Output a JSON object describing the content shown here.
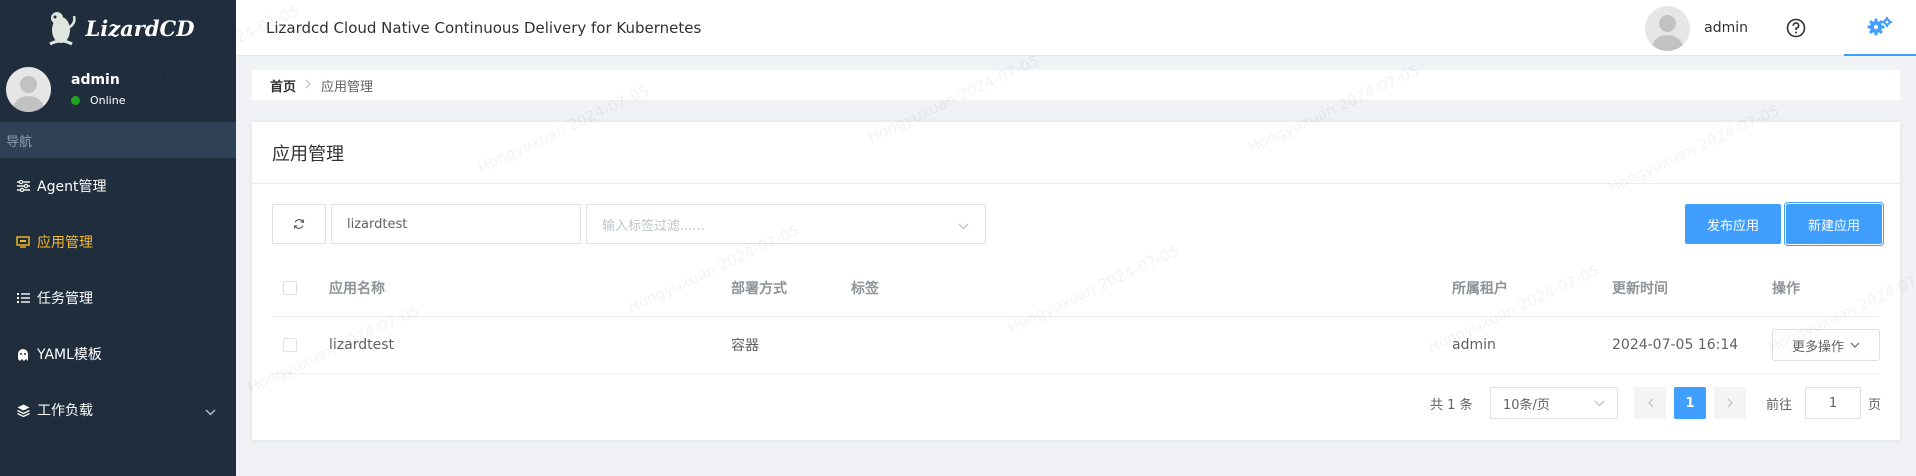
{
  "sidebar": {
    "logo_text": "LizardCD",
    "user": {
      "name": "admin",
      "status": "Online"
    },
    "nav_header": "导航",
    "items": [
      {
        "label": "Agent管理",
        "icon": "sliders-icon"
      },
      {
        "label": "应用管理",
        "icon": "app-icon",
        "active": true
      },
      {
        "label": "任务管理",
        "icon": "tasks-icon"
      },
      {
        "label": "YAML模板",
        "icon": "ghost-icon"
      },
      {
        "label": "工作负载",
        "icon": "layers-icon",
        "has_submenu": true
      }
    ]
  },
  "header": {
    "title": "Lizardcd Cloud Native Continuous Delivery for Kubernetes",
    "user": "admin",
    "help_icon": "question-circle-icon",
    "settings_icon": "gears-icon"
  },
  "breadcrumb": {
    "home": "首页",
    "current": "应用管理"
  },
  "page": {
    "title": "应用管理",
    "search_value": "lizardtest",
    "tag_placeholder": "输入标签过滤......",
    "publish_label": "发布应用",
    "new_label": "新建应用"
  },
  "table": {
    "columns": [
      "应用名称",
      "部署方式",
      "标签",
      "所属租户",
      "更新时间",
      "操作"
    ],
    "rows": [
      {
        "name": "lizardtest",
        "deploy": "容器",
        "tags": "",
        "tenant": "admin",
        "updated": "2024-07-05 16:14",
        "action": "更多操作"
      }
    ]
  },
  "pagination": {
    "total_text": "共 1 条",
    "page_size": "10条/页",
    "current_page": "1",
    "goto_label": "前往",
    "goto_value": "1",
    "page_suffix": "页"
  },
  "watermark": "Hongyuxuan 2024-07-05",
  "colors": {
    "sidebar_bg": "#1f2d3d",
    "accent": "#409eff",
    "active_nav": "#f7ba2a",
    "online": "#1ea51e"
  }
}
